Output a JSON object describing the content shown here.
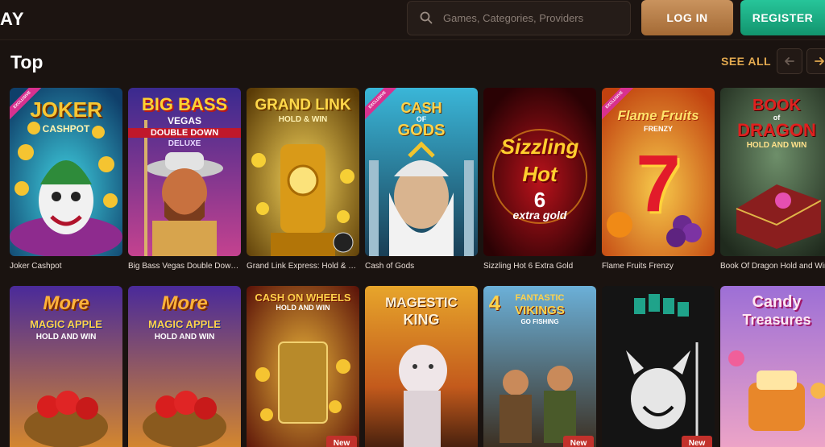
{
  "header": {
    "logo_text": "AY",
    "search_placeholder": "Games, Categories, Providers",
    "login_label": "LOG IN",
    "register_label": "REGISTER"
  },
  "section": {
    "title": "Top",
    "see_all_label": "SEE ALL"
  },
  "row1": [
    {
      "caption": "Joker Cashpot",
      "art_title": "JOKER",
      "art_sub": "CASHPOT",
      "ribbon": "EXCLUSIVE"
    },
    {
      "caption": "Big Bass Vegas Double Down Deluxe",
      "art_title": "BIG BASS",
      "art_mid": "VEGAS",
      "art_sub": "DOUBLE DOWN",
      "art_sub2": "DELUXE"
    },
    {
      "caption": "Grand Link Express: Hold & Win",
      "art_title": "GRAND LINK",
      "art_sub": "HOLD & WIN"
    },
    {
      "caption": "Cash of Gods",
      "art_title": "CASH",
      "art_mid": "OF",
      "art_sub": "GODS",
      "ribbon": "EXCLUSIVE"
    },
    {
      "caption": "Sizzling Hot 6 Extra Gold",
      "art_title": "Sizzling",
      "art_mid": "Hot",
      "art_num": "6",
      "art_sub": "extra gold"
    },
    {
      "caption": "Flame Fruits Frenzy",
      "art_title": "Flame Fruits",
      "art_sub": "FRENZY",
      "art_num": "7",
      "ribbon": "EXCLUSIVE"
    },
    {
      "caption": "Book Of Dragon Hold and Win",
      "art_title": "BOOK",
      "art_mid": "of",
      "art_sub": "DRAGON",
      "art_sub2": "HOLD AND WIN"
    }
  ],
  "row2": [
    {
      "art_title": "More",
      "art_mid": "MAGIC APPLE",
      "art_sub": "HOLD AND WIN"
    },
    {
      "art_title": "More",
      "art_mid": "MAGIC APPLE",
      "art_sub": "HOLD AND WIN"
    },
    {
      "art_title": "CASH ON WHEELS",
      "art_sub": "HOLD AND WIN",
      "badge": "New"
    },
    {
      "art_title": "MAGESTIC",
      "art_sub": "KING"
    },
    {
      "art_title": "FANTASTIC",
      "art_mid": "VIKINGS",
      "art_num": "4",
      "art_sub": "GO FISHING",
      "badge": "New"
    },
    {
      "art_title": "",
      "badge": "New"
    },
    {
      "art_title": "Candy",
      "art_sub": "Treasures"
    }
  ],
  "colors": {
    "background": "#1a1310",
    "accent_gold": "#e2a94f",
    "login_button": "#b97e46",
    "register_button": "#1fb386",
    "badge_new": "#c2312b",
    "ribbon": "#d8318f"
  },
  "icons": {
    "search": "search-icon",
    "prev": "chevron-left-icon",
    "next": "chevron-right-icon"
  }
}
